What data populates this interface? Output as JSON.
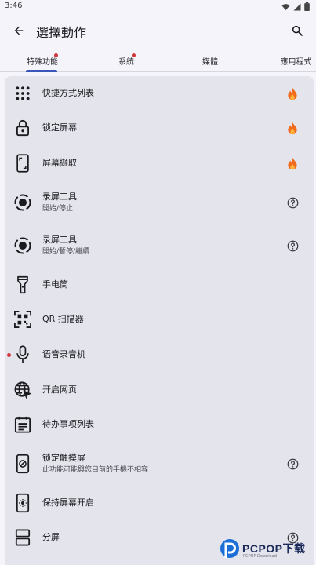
{
  "status_bar": {
    "time": "3:46"
  },
  "app_bar": {
    "title": "選擇動作"
  },
  "tabs": [
    {
      "label": "特殊功能",
      "selected": true,
      "dot": true
    },
    {
      "label": "系統",
      "selected": false,
      "dot": true
    },
    {
      "label": "媒體",
      "selected": false,
      "dot": false
    },
    {
      "label": "應用程式",
      "selected": false,
      "dot": false
    }
  ],
  "items": [
    {
      "title": "快捷方式列表",
      "subtitle": "",
      "icon": "grid-dots-icon",
      "trailing": "fire-icon"
    },
    {
      "title": "锁定屏幕",
      "subtitle": "",
      "icon": "lock-icon",
      "trailing": "fire-icon"
    },
    {
      "title": "屏幕撷取",
      "subtitle": "",
      "icon": "screenshot-icon",
      "trailing": "fire-icon"
    },
    {
      "title": "录屏工具",
      "subtitle": "開始/停止",
      "icon": "record-icon",
      "trailing": "help-icon"
    },
    {
      "title": "录屏工具",
      "subtitle": "開始/暫停/繼續",
      "icon": "record-icon",
      "trailing": "help-icon"
    },
    {
      "title": "手电筒",
      "subtitle": "",
      "icon": "flashlight-icon",
      "trailing": ""
    },
    {
      "title": "QR 扫描器",
      "subtitle": "",
      "icon": "qr-scan-icon",
      "trailing": ""
    },
    {
      "title": "语音录音机",
      "subtitle": "",
      "icon": "microphone-icon",
      "trailing": "",
      "dot": true
    },
    {
      "title": "开启网页",
      "subtitle": "",
      "icon": "web-icon",
      "trailing": ""
    },
    {
      "title": "待办事项列表",
      "subtitle": "",
      "icon": "todo-icon",
      "trailing": ""
    },
    {
      "title": "锁定触摸屏",
      "subtitle": "此功能可能與您目前的手機不相容",
      "icon": "touch-lock-icon",
      "trailing": "help-icon"
    },
    {
      "title": "保持屏幕开启",
      "subtitle": "",
      "icon": "screen-on-icon",
      "trailing": ""
    },
    {
      "title": "分屏",
      "subtitle": "",
      "icon": "split-screen-icon",
      "trailing": "help-icon"
    }
  ],
  "watermark": {
    "text": "PCPOP下载",
    "sub": "PCPOP Download"
  },
  "colors": {
    "accent": "#3a56b8",
    "dot": "#d1353a",
    "list_bg": "#e4e4ec",
    "page_bg": "#f4f4fa"
  }
}
